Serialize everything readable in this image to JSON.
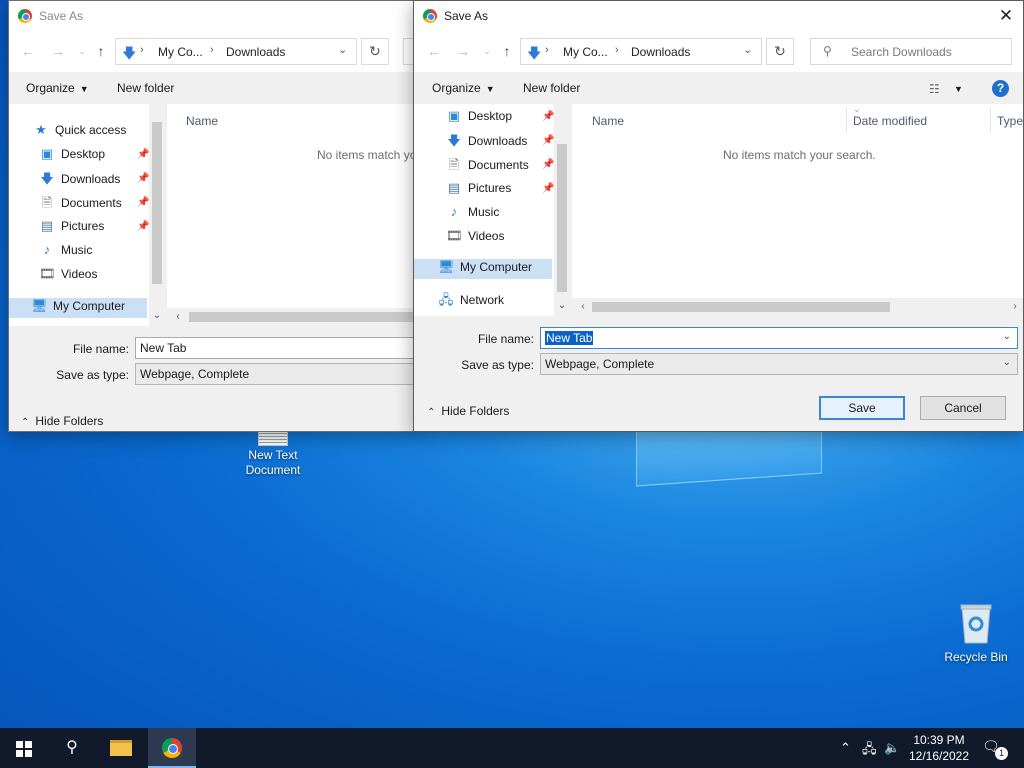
{
  "desktop": {
    "icons": [
      {
        "label_line1": "New Text",
        "label_line2": "Document"
      },
      {
        "label_line1": "Recycle Bin",
        "label_line2": ""
      }
    ]
  },
  "back_dialog": {
    "title": "Save As",
    "breadcrumb": [
      "My Co...",
      "Downloads"
    ],
    "toolbar": {
      "organize": "Organize",
      "new_folder": "New folder"
    },
    "tree": [
      {
        "label": "Quick access",
        "icon": "star-icon"
      },
      {
        "label": "Desktop",
        "icon": "desktop-icon"
      },
      {
        "label": "Downloads",
        "icon": "downloads-icon"
      },
      {
        "label": "Documents",
        "icon": "documents-icon"
      },
      {
        "label": "Pictures",
        "icon": "pictures-icon"
      },
      {
        "label": "Music",
        "icon": "music-icon"
      },
      {
        "label": "Videos",
        "icon": "videos-icon"
      },
      {
        "label": "My Computer",
        "icon": "computer-icon"
      }
    ],
    "column_name": "Name",
    "empty_text": "No items match yo",
    "file_name_label": "File name:",
    "file_name_value": "New Tab",
    "save_type_label": "Save as type:",
    "save_type_value": "Webpage, Complete",
    "hide_folders": "Hide Folders"
  },
  "front_dialog": {
    "title": "Save As",
    "breadcrumb": [
      "My Co...",
      "Downloads"
    ],
    "search_placeholder": "Search Downloads",
    "toolbar": {
      "organize": "Organize",
      "new_folder": "New folder"
    },
    "tree": [
      {
        "label": "Desktop",
        "icon": "desktop-icon"
      },
      {
        "label": "Downloads",
        "icon": "downloads-icon"
      },
      {
        "label": "Documents",
        "icon": "documents-icon"
      },
      {
        "label": "Pictures",
        "icon": "pictures-icon"
      },
      {
        "label": "Music",
        "icon": "music-icon"
      },
      {
        "label": "Videos",
        "icon": "videos-icon"
      },
      {
        "label": "My Computer",
        "icon": "computer-icon"
      },
      {
        "label": "Network",
        "icon": "network-icon"
      }
    ],
    "columns": [
      "Name",
      "Date modified",
      "Type"
    ],
    "empty_text": "No items match your search.",
    "file_name_label": "File name:",
    "file_name_value": "New Tab",
    "save_type_label": "Save as type:",
    "save_type_value": "Webpage, Complete",
    "hide_folders": "Hide Folders",
    "save_button": "Save",
    "cancel_button": "Cancel"
  },
  "taskbar": {
    "time": "10:39 PM",
    "date": "12/16/2022",
    "notification_count": "1"
  },
  "colors": {
    "accent": "#0a62c9",
    "taskbar": "#101a2b",
    "selection": "#cce0f5"
  }
}
